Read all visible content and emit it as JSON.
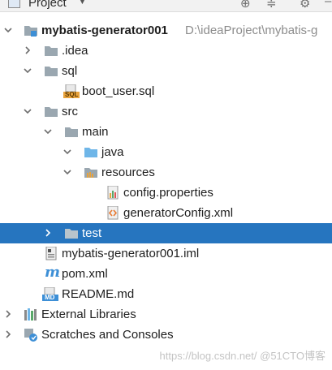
{
  "header": {
    "title": "Project"
  },
  "tree": {
    "root": {
      "label": "mybatis-generator001",
      "path": "D:\\ideaProject\\mybatis-g"
    },
    "idea": {
      "label": ".idea"
    },
    "sql": {
      "label": "sql"
    },
    "boot_user_sql": {
      "label": "boot_user.sql",
      "badge": "SQL"
    },
    "src": {
      "label": "src"
    },
    "main": {
      "label": "main"
    },
    "java": {
      "label": "java"
    },
    "resources": {
      "label": "resources"
    },
    "config_properties": {
      "label": "config.properties"
    },
    "generator_config": {
      "label": "generatorConfig.xml"
    },
    "test": {
      "label": "test"
    },
    "iml": {
      "label": "mybatis-generator001.iml"
    },
    "pom": {
      "label": "pom.xml"
    },
    "readme": {
      "label": "README.md",
      "badge": "MD"
    },
    "external_libraries": {
      "label": "External Libraries"
    },
    "scratches": {
      "label": "Scratches and Consoles"
    }
  },
  "icons": {
    "toolbar": [
      "target-icon",
      "collapse-icon",
      "gear-icon",
      "minimize-icon"
    ]
  },
  "colors": {
    "selection": "#2675bf",
    "folder": "#9aa7b0",
    "source_folder": "#6fb6e8"
  },
  "watermark": "https://blog.csdn.net/ @51CTO博客"
}
